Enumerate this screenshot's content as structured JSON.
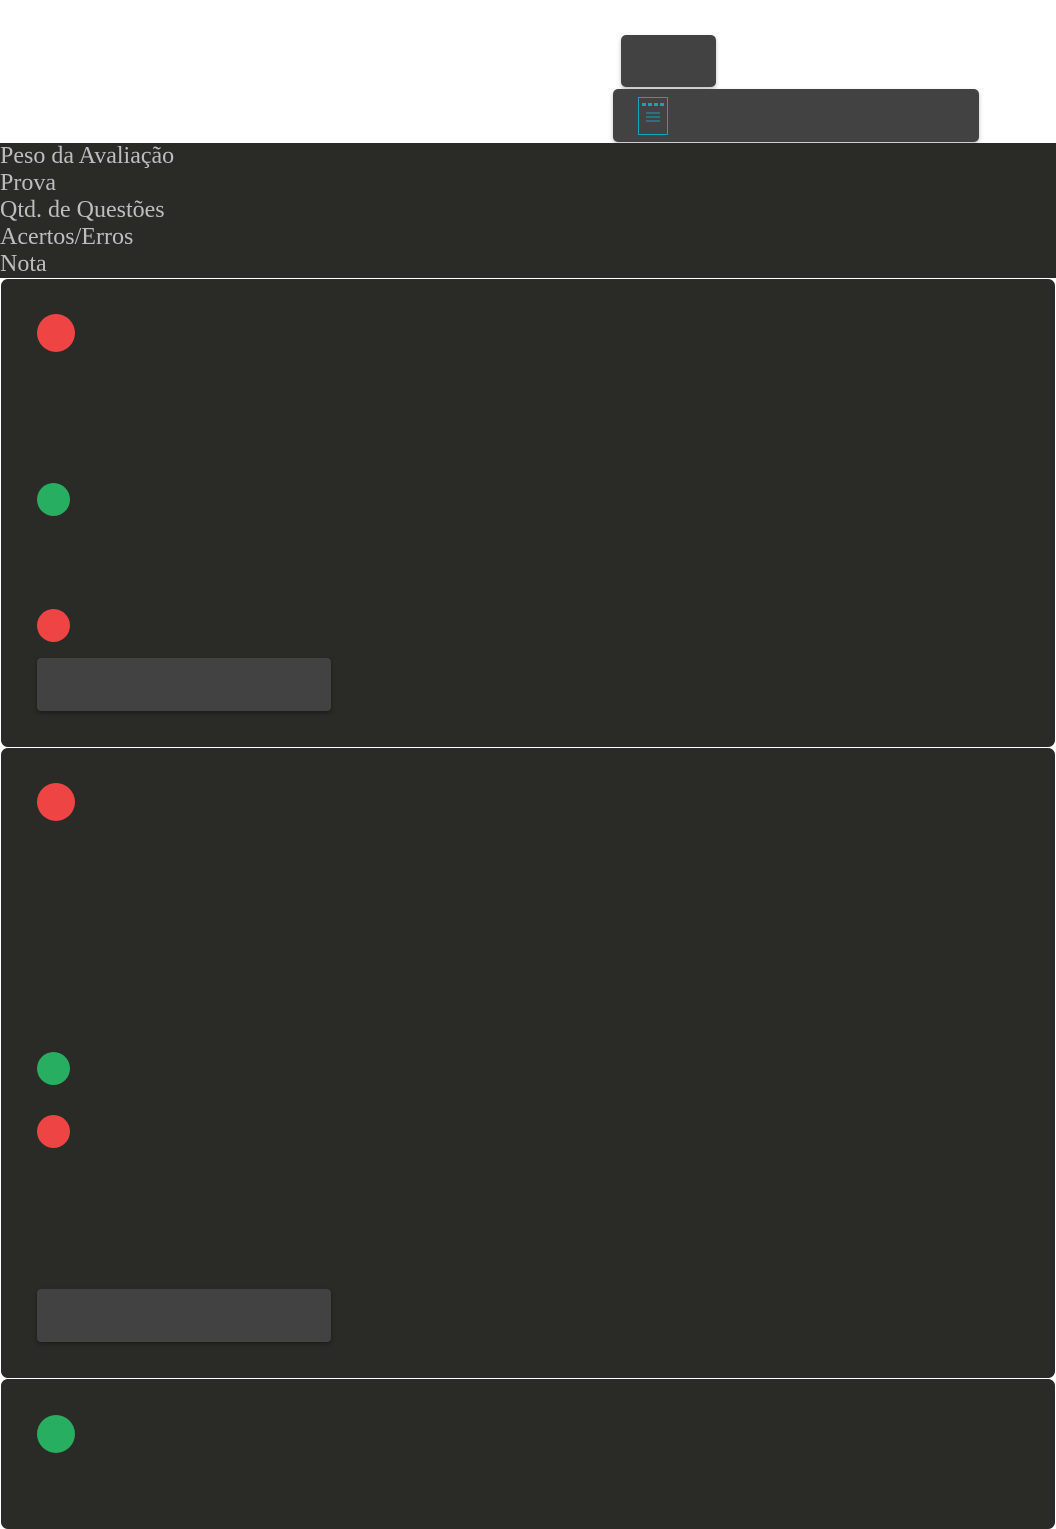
{
  "toolbar": {
    "icon": "document-list-icon",
    "icon_color": "#17a2b8"
  },
  "header": {
    "labels": [
      "Peso da Avaliação",
      "Prova",
      "Qtd. de Questões",
      "Acertos/Erros",
      "Nota"
    ]
  },
  "colors": {
    "status_incorrect": "#ef4444",
    "status_correct": "#27ae60",
    "panel_bg": "#2a2a27",
    "button_bg": "#424243"
  },
  "cards": [
    {
      "indicators": [
        "incorrect",
        "correct",
        "incorrect"
      ]
    },
    {
      "indicators": [
        "incorrect",
        "correct",
        "incorrect"
      ]
    },
    {
      "indicators": [
        "correct"
      ]
    }
  ]
}
